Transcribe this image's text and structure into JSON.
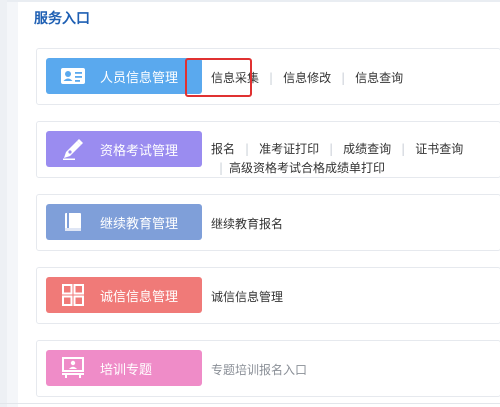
{
  "section": {
    "title": "服务入口"
  },
  "cards": [
    {
      "title": "人员信息管理",
      "color": "#5aa9ee",
      "icon": "id-card-icon",
      "links": [
        "信息采集",
        "信息修改",
        "信息查询"
      ]
    },
    {
      "title": "资格考试管理",
      "color": "#9a8cf0",
      "icon": "pen-icon",
      "links_line1": [
        "报名",
        "准考证打印",
        "成绩查询",
        "证书查询"
      ],
      "links_line2": [
        "高级资格考试合格成绩单打印"
      ]
    },
    {
      "title": "继续教育管理",
      "color": "#7f9fd9",
      "icon": "book-icon",
      "links": [
        "继续教育报名"
      ]
    },
    {
      "title": "诚信信息管理",
      "color": "#f07a78",
      "icon": "grid-icon",
      "links": [
        "诚信信息管理"
      ]
    },
    {
      "title": "培训专题",
      "color": "#ef8cc8",
      "icon": "presentation-icon",
      "links": [
        "专题培训报名入口"
      ],
      "link_color": "#8a8f97"
    }
  ]
}
